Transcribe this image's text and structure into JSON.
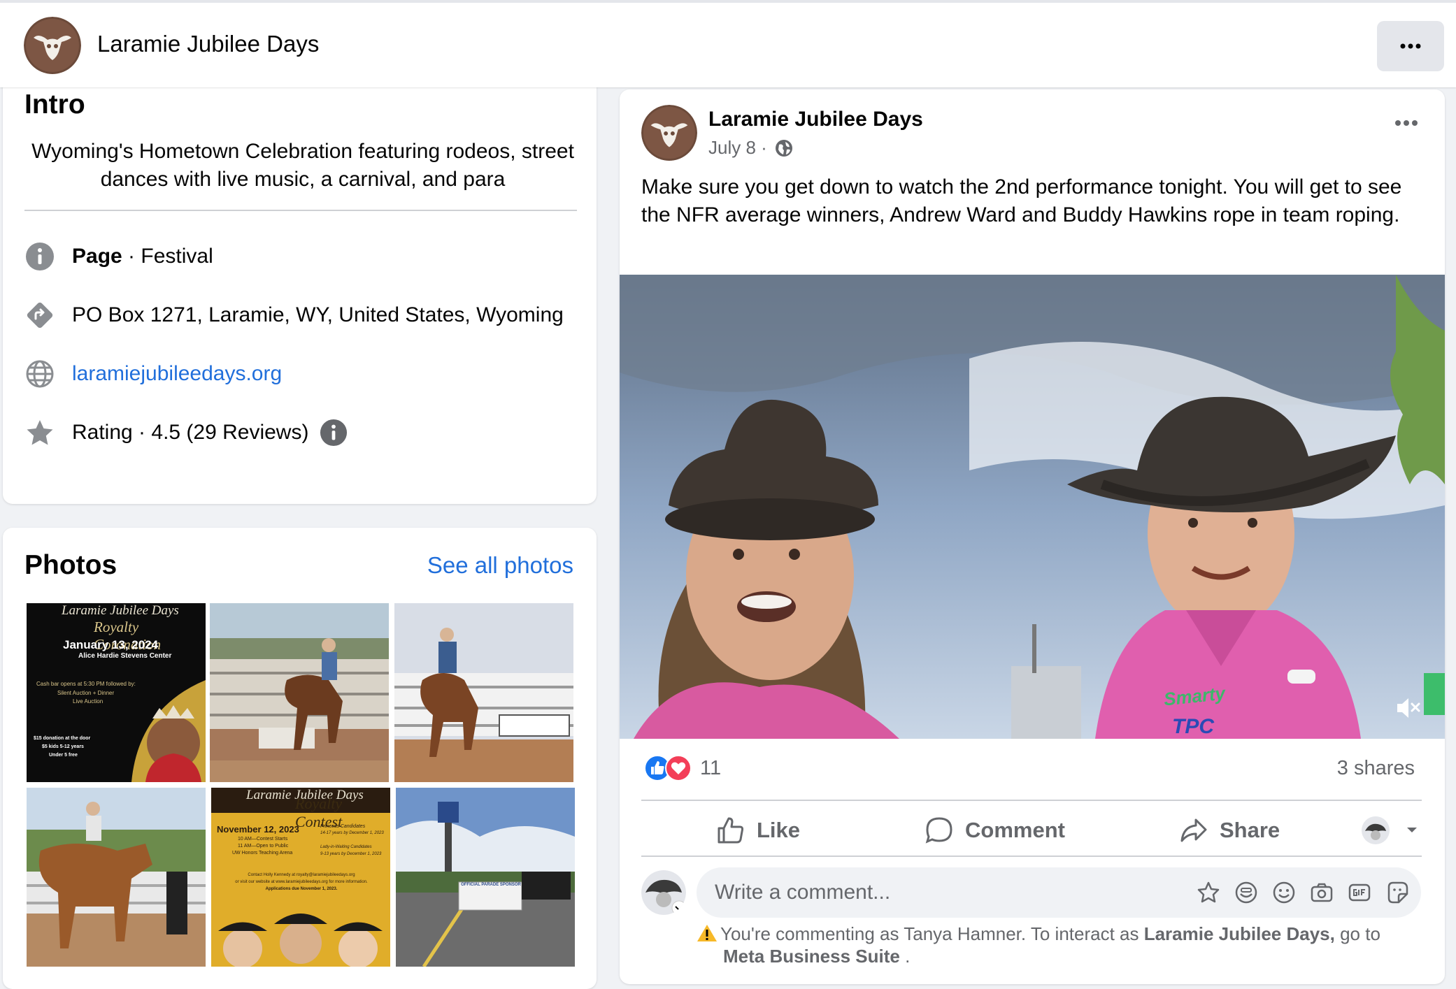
{
  "header": {
    "page_name": "Laramie Jubilee Days",
    "avatar_icon": "bull-skull-logo",
    "more_icon": "more-horizontal-icon"
  },
  "intro": {
    "title": "Intro",
    "bio": "Wyoming's Hometown Celebration featuring rodeos, street dances with live music, a carnival, and para",
    "category_label": "Page",
    "category_sep": " · ",
    "category_value": "Festival",
    "address": "PO Box 1271, Laramie, WY, United States, Wyoming",
    "website": "laramiejubileedays.org",
    "rating": "Rating · 4.5 (29 Reviews)"
  },
  "photos": {
    "title": "Photos",
    "see_all": "See all photos",
    "items": [
      {
        "alt": "Royalty Coronation flyer",
        "lines": [
          "Laramie Jubilee Days",
          "Royalty Coronation",
          "January 13, 2024",
          "Alice Hardie Stevens Center",
          "Cash bar opens at 5:30 PM followed by:",
          "Silent Auction + Dinner",
          "Live Auction",
          "$15 donation at the door",
          "$5 kids 5-12 years",
          "Under 5 free"
        ]
      },
      {
        "alt": "Bronc rider at rodeo chutes"
      },
      {
        "alt": "Saddle bronc rider in arena"
      },
      {
        "alt": "Bareback bronc rider"
      },
      {
        "alt": "Royalty Contest flyer",
        "lines": [
          "Laramie Jubilee Days",
          "Royalty Contest",
          "November 12, 2023",
          "10 AM—Contest Starts",
          "11 AM—Open to Public",
          "UW Honors Teaching Arena",
          "Princess Candidates",
          "14-17 years by December 1, 2023",
          "Lady-in-Waiting Candidates",
          "9-13 years by December 1, 2023",
          "Contact Holly Kennedy at royalty@laramiejubileedays.org",
          "or visit our website at www.laramiejubileedays.org for more information.",
          "Applications due November 1, 2023."
        ]
      },
      {
        "alt": "Parade street with banner",
        "lines": [
          "OFFICIAL PARADE SPONSOR"
        ]
      }
    ]
  },
  "post": {
    "author": "Laramie Jubilee Days",
    "date": "July 8",
    "date_sep": " · ",
    "privacy_icon": "globe-icon",
    "text": "Make sure you get down to watch the 2nd performance tonight. You will get to see the NFR average winners, Andrew Ward and Buddy Hawkins rope in team roping.",
    "video_alt": "Two people in cowboy hats and pink shirts speaking to camera outdoors",
    "video_shirt_text": "Smarty",
    "video_shirt_text2": "TPC",
    "mute_icon": "volume-muted-icon",
    "reaction_count": "11",
    "shares": "3 shares",
    "actions": {
      "like": "Like",
      "comment": "Comment",
      "share": "Share"
    },
    "comment_placeholder": "Write a comment...",
    "notice_prefix": "You're commenting as Tanya Hamner. To interact as ",
    "notice_page": "Laramie Jubilee Days,",
    "notice_middle": " go to",
    "notice_suite": "Meta Business Suite",
    "notice_suffix": " .",
    "colors": {
      "like_blue": "#1877f2",
      "love_red": "#f33e58",
      "link_blue": "#216fdb",
      "warning_yellow": "#f7b928"
    }
  }
}
